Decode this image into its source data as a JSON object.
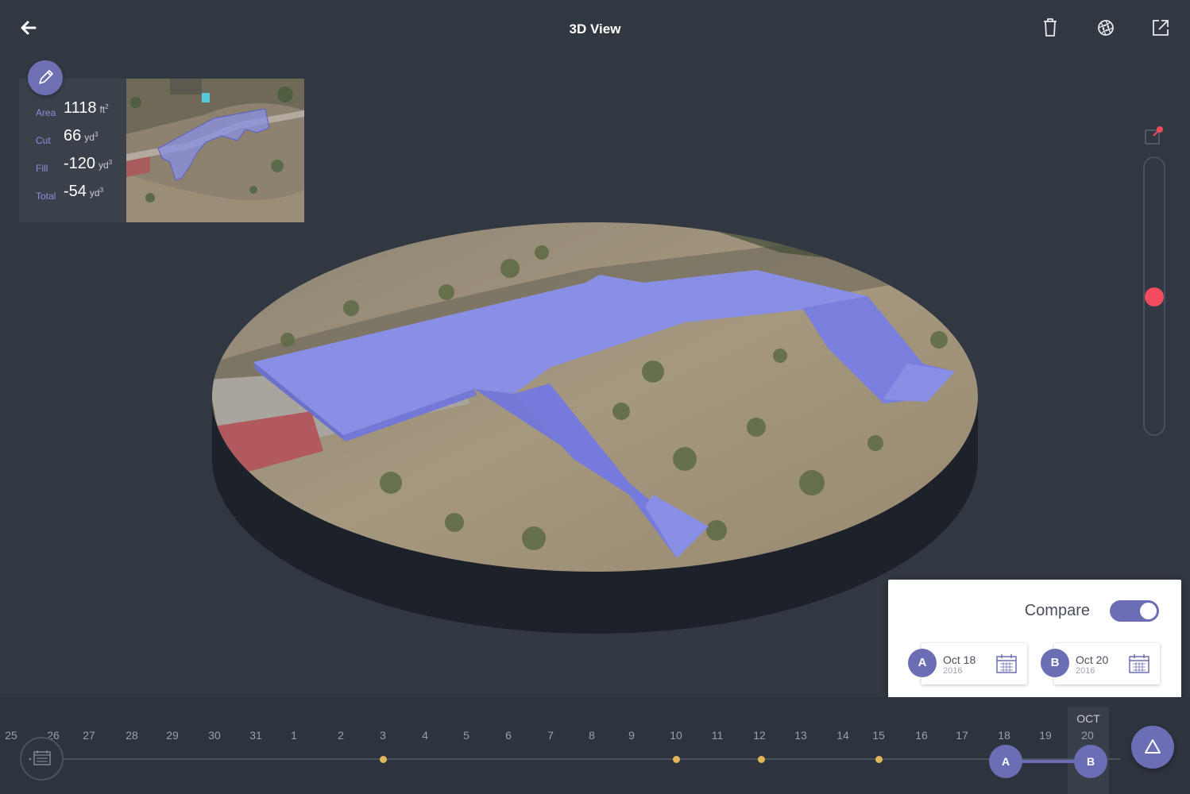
{
  "header": {
    "title": "3D View",
    "back_icon": "arrow-left-icon",
    "actions": [
      "trash-icon",
      "aperture-icon",
      "export-icon"
    ]
  },
  "measurements": {
    "edit_icon": "pencil-icon",
    "rows": [
      {
        "label": "Area",
        "value": "1118",
        "unit": "ft",
        "power": "2"
      },
      {
        "label": "Cut",
        "value": "66",
        "unit": "yd",
        "power": "3"
      },
      {
        "label": "Fill",
        "value": "-120",
        "unit": "yd",
        "power": "3"
      },
      {
        "label": "Total",
        "value": "-54",
        "unit": "yd",
        "power": "3"
      }
    ]
  },
  "elevation_slider": {
    "icon": "pin-marker-icon",
    "level": 0.5
  },
  "compare": {
    "label": "Compare",
    "enabled": true,
    "date_a": {
      "badge": "A",
      "date": "Oct 18",
      "year": "2016"
    },
    "date_b": {
      "badge": "B",
      "date": "Oct 20",
      "year": "2016"
    }
  },
  "timeline": {
    "month": "OCT",
    "days": [
      "25",
      "26",
      "27",
      "28",
      "29",
      "30",
      "31",
      "1",
      "2",
      "3",
      "4",
      "5",
      "6",
      "7",
      "8",
      "9",
      "10",
      "11",
      "12",
      "13",
      "14",
      "15",
      "16",
      "17",
      "18",
      "19",
      "20"
    ],
    "markers": {
      "a": "A",
      "b": "B"
    },
    "fab_icon": "triangle-icon",
    "calendar_icon": "calendar-icon"
  },
  "colors": {
    "background": "#323841",
    "accent": "#6b6eb4",
    "slider_thumb": "#f34b5e",
    "timeline_dot": "#e5b55a",
    "volume_fill": "#8a8fe6"
  }
}
